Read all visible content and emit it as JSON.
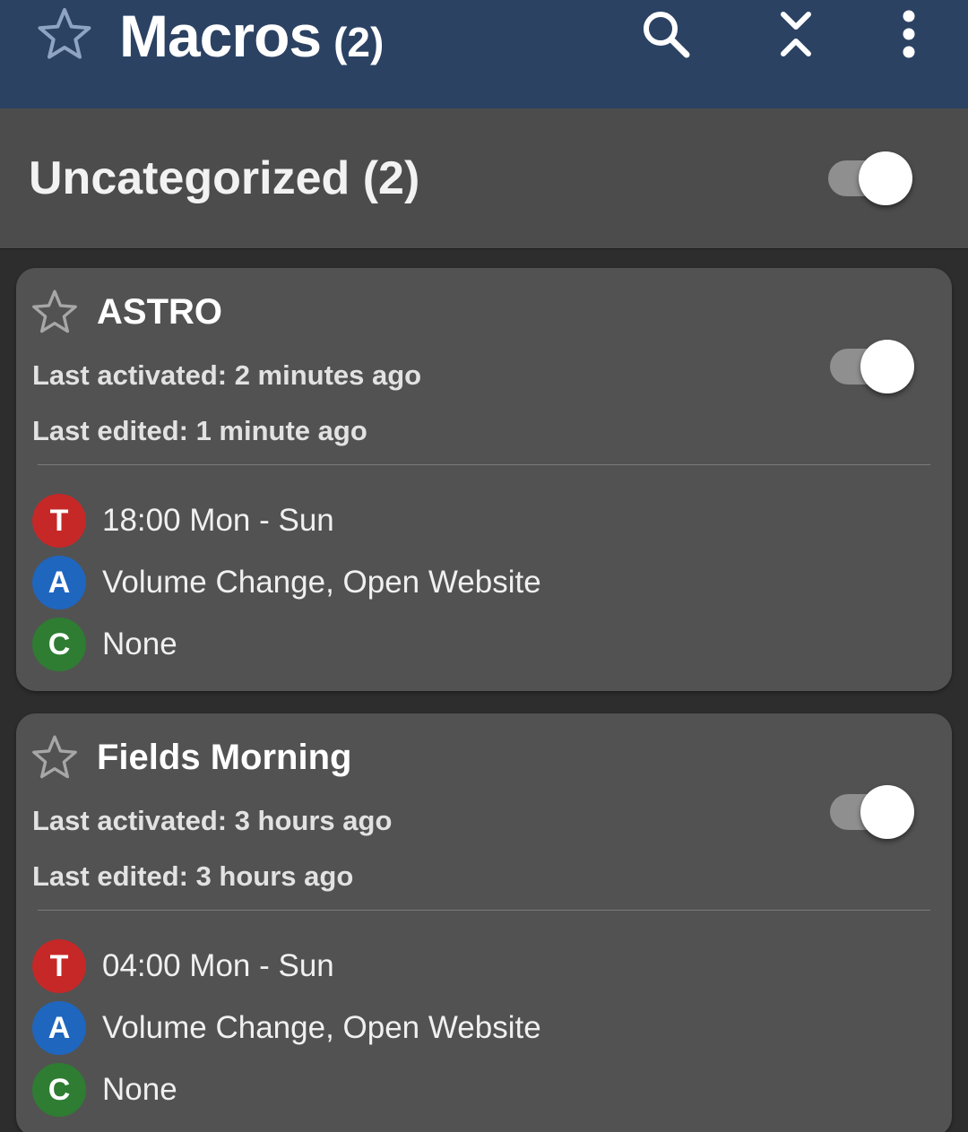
{
  "colors": {
    "toolbar_bg": "#2b4263",
    "category_bg": "#4c4c4c",
    "card_bg": "#525252",
    "screen_bg": "#2d2d2d",
    "trigger_badge": "#c62828",
    "action_badge": "#1f66bf",
    "constraint_badge": "#2e7d32"
  },
  "toolbar": {
    "title": "Macros",
    "count": "(2)",
    "icons": {
      "favorite": "star-outline-icon",
      "search": "search-icon",
      "collapse": "collapse-expand-icon",
      "more": "more-vert-icon"
    }
  },
  "category": {
    "title": "Uncategorized (2)",
    "enabled": true
  },
  "macros": [
    {
      "name": "ASTRO",
      "last_activated": "Last activated: 2 minutes ago",
      "last_edited": "Last edited: 1 minute ago",
      "enabled": true,
      "trigger_letter": "T",
      "trigger": "18:00 Mon - Sun",
      "action_letter": "A",
      "actions": "Volume Change, Open Website",
      "constraint_letter": "C",
      "constraints": "None"
    },
    {
      "name": "Fields Morning",
      "last_activated": "Last activated: 3 hours ago",
      "last_edited": "Last edited: 3 hours ago",
      "enabled": true,
      "trigger_letter": "T",
      "trigger": "04:00 Mon - Sun",
      "action_letter": "A",
      "actions": "Volume Change, Open Website",
      "constraint_letter": "C",
      "constraints": "None"
    }
  ]
}
